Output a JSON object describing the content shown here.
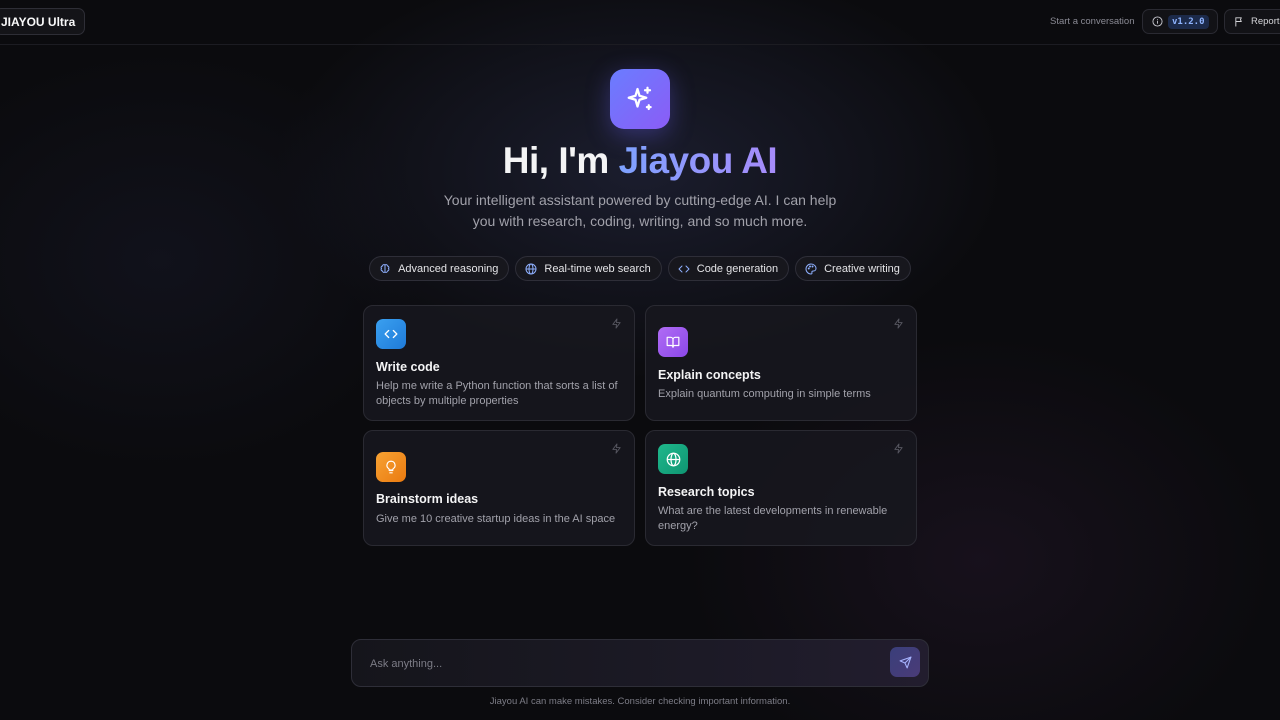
{
  "header": {
    "brand": "JIAYOU Ultra",
    "start_conversation": "Start a conversation",
    "version": "v1.2.0",
    "report_label": "Report"
  },
  "hero": {
    "icon": "sparkles-icon",
    "title_prefix": "Hi, I'm ",
    "title_accent": "Jiayou AI",
    "subtitle": "Your intelligent assistant powered by cutting-edge AI. I can help you with research, coding, writing, and so much more."
  },
  "capabilities": [
    {
      "label": "Advanced reasoning",
      "icon": "brain-icon"
    },
    {
      "label": "Real-time web search",
      "icon": "globe-icon"
    },
    {
      "label": "Code generation",
      "icon": "code-icon"
    },
    {
      "label": "Creative writing",
      "icon": "palette-icon"
    }
  ],
  "suggestions": [
    {
      "title": "Write code",
      "description": "Help me write a Python function that sorts a list of objects by multiple properties",
      "icon": "code-icon",
      "color": "#2f8fe8"
    },
    {
      "title": "Explain concepts",
      "description": "Explain quantum computing in simple terms",
      "icon": "book-icon",
      "color": "#9b5cf0"
    },
    {
      "title": "Brainstorm ideas",
      "description": "Give me 10 creative startup ideas in the AI space",
      "icon": "lightbulb-icon",
      "color": "#f08a1c"
    },
    {
      "title": "Research topics",
      "description": "What are the latest developments in renewable energy?",
      "icon": "globe-icon",
      "color": "#14a37f"
    }
  ],
  "composer": {
    "placeholder": "Ask anything...",
    "send_icon": "send-icon"
  },
  "footer": {
    "disclaimer": "Jiayou AI can make mistakes. Consider checking important information."
  }
}
